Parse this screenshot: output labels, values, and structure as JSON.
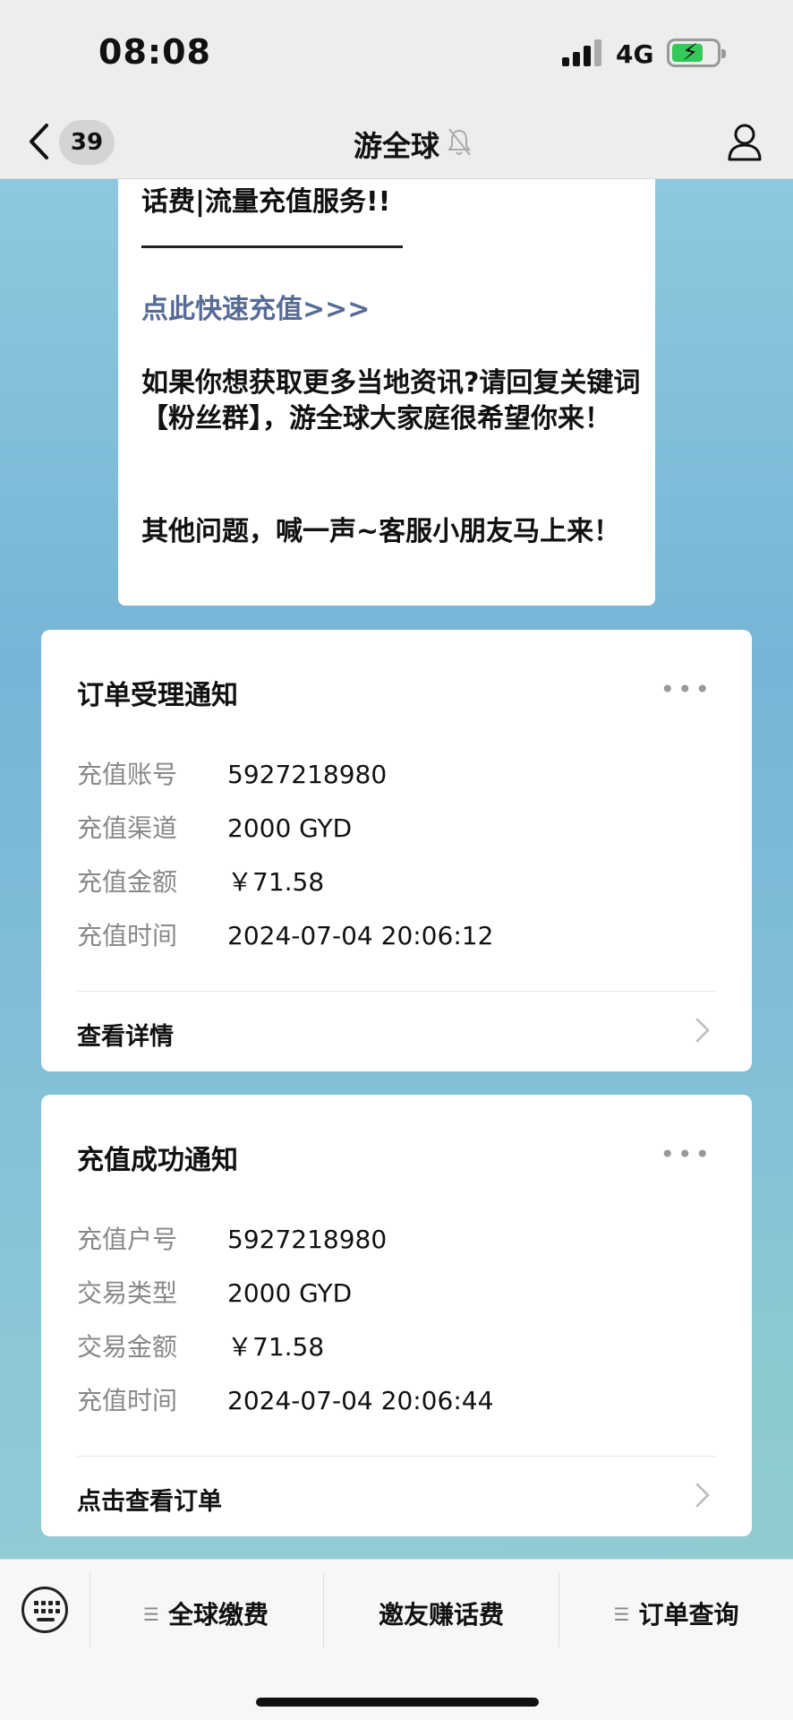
{
  "status_bar": {
    "time": "08:08",
    "network": "4G"
  },
  "nav": {
    "unread_count": "39",
    "title": "游全球"
  },
  "message": {
    "line1": "话费|流量充值服务!!",
    "link": "点此快速充值>>>",
    "para2": "如果你想获取更多当地资讯?请回复关键词【粉丝群】，游全球大家庭很希望你来！",
    "para3": "其他问题，喊一声~客服小朋友马上来！"
  },
  "order_card": {
    "title": "订单受理通知",
    "more": "•••",
    "rows": [
      {
        "label": "充值账号",
        "value": "5927218980"
      },
      {
        "label": "充值渠道",
        "value": "2000 GYD"
      },
      {
        "label": "充值金额",
        "value": "￥71.58"
      },
      {
        "label": "充值时间",
        "value": "2024-07-04 20:06:12"
      }
    ],
    "footer": "查看详情"
  },
  "success_card": {
    "title": "充值成功通知",
    "more": "•••",
    "rows": [
      {
        "label": "充值户号",
        "value": "5927218980"
      },
      {
        "label": "交易类型",
        "value": "2000 GYD"
      },
      {
        "label": "交易金额",
        "value": "￥71.58"
      },
      {
        "label": "充值时间",
        "value": "2024-07-04 20:06:44"
      }
    ],
    "footer": "点击查看订单"
  },
  "bottom_menu": {
    "items": [
      {
        "label": "全球缴费",
        "has_submenu": true
      },
      {
        "label": "邀友赚话费",
        "has_submenu": false
      },
      {
        "label": "订单查询",
        "has_submenu": true
      }
    ]
  },
  "colors": {
    "link": "#576b95",
    "battery": "#34c759",
    "chat_bg": "#7ab8d8"
  }
}
